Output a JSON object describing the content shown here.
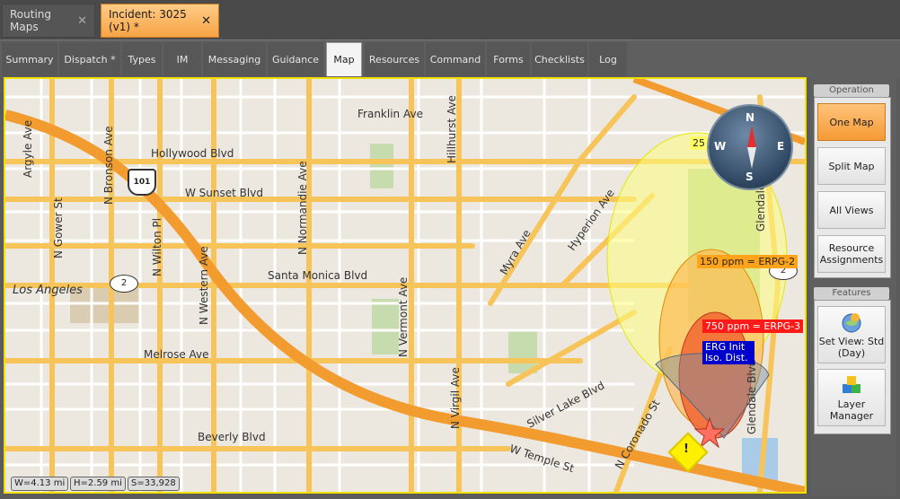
{
  "doc_tabs": [
    {
      "label": "Routing Maps",
      "close": "✕"
    },
    {
      "label": "Incident: 3025 (v1) *",
      "close": "✕"
    }
  ],
  "tabs": [
    "Summary",
    "Dispatch *",
    "Types",
    "IM",
    "Messaging",
    "Guidance",
    "Map",
    "Resources",
    "Command",
    "Forms",
    "Checklists",
    "Log"
  ],
  "active_tab": "Map",
  "map": {
    "streets": {
      "franklin": "Franklin Ave",
      "hollywood": "Hollywood Blvd",
      "sunset": "W Sunset Blvd",
      "santa_monica": "Santa Monica Blvd",
      "melrose": "Melrose Ave",
      "beverly": "Beverly Blvd",
      "temple": "W Temple St",
      "silver_lake": "Silver Lake Blvd",
      "argyle": "Argyle Ave",
      "gower": "N Gower St",
      "bronson": "N Bronson Ave",
      "wilton": "N Wilton Pl",
      "western": "N Western Ave",
      "normandie": "N Normandie Ave",
      "vermont": "N Vermont Ave",
      "hillhurst": "Hillhurst Ave",
      "virgil": "N Virgil Ave",
      "myra": "Myra Ave",
      "hyperion": "Hyperion Ave",
      "glendale_blvd": "Glendale Blvd",
      "glendale": "Glendale",
      "coronado": "N Coronado St"
    },
    "city": "Los Angeles",
    "shields": {
      "us101": "101",
      "r2a": "2",
      "r2b": "2"
    },
    "zones": [
      {
        "label": "25 ppm = ERPG-1",
        "color": "#ffff66"
      },
      {
        "label": "150 ppm = ERPG-2",
        "color": "#ffa31a"
      },
      {
        "label": "750 ppm = ERPG-3",
        "color": "#ff1a1a"
      },
      {
        "label": "ERG Init Iso. Dist.",
        "color": "#0000cc"
      }
    ],
    "compass": {
      "n": "N",
      "s": "S",
      "e": "E",
      "w": "W"
    },
    "incident_marker": "!",
    "scale": {
      "w": "W=4.13 mi",
      "h": "H=2.59 mi",
      "s": "S=33,928"
    }
  },
  "sidebar": {
    "operation_title": "Operation",
    "operation_buttons": [
      "One Map",
      "Split Map",
      "All Views",
      "Resource Assignments"
    ],
    "active_button": "One Map",
    "features_title": "Features",
    "feature_buttons": [
      {
        "label": "Set View: Std (Day)",
        "icon": "globe-icon"
      },
      {
        "label": "Layer Manager",
        "icon": "layers-icon"
      }
    ]
  }
}
